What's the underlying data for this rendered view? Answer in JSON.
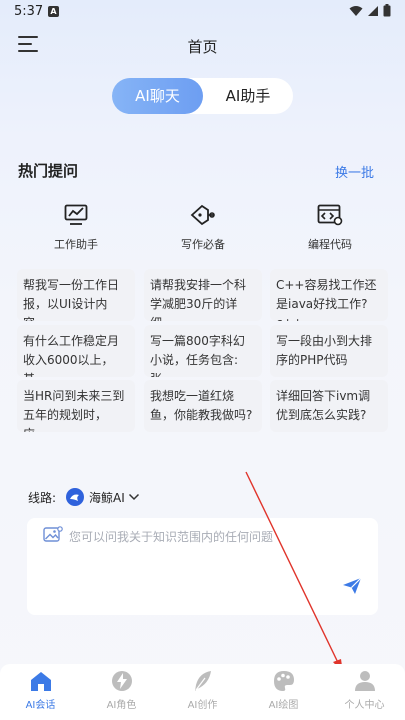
{
  "status": {
    "time": "5:37"
  },
  "header": {
    "title": "首页"
  },
  "tabs": [
    {
      "label": "AI聊天",
      "active": true
    },
    {
      "label": "AI助手",
      "active": false
    }
  ],
  "hot": {
    "title": "热门提问",
    "refresh": "换一批",
    "categories": [
      {
        "icon": "chart-monitor-icon",
        "label": "工作助手"
      },
      {
        "icon": "pen-nib-icon",
        "label": "写作必备"
      },
      {
        "icon": "code-window-icon",
        "label": "编程代码"
      }
    ],
    "cards": [
      {
        "text": "帮我写一份工作日报，以UI设计内容…"
      },
      {
        "text": "请帮我安排一个科学减肥30斤的详细…"
      },
      {
        "text": "C++容易找工作还是iava好找工作?c++…"
      },
      {
        "text": "有什么工作稳定月收入6000以上，基…"
      },
      {
        "text": "写一篇800字科幻小说，任务包含: 张…"
      },
      {
        "text": "写一段由小到大排序的PHP代码"
      },
      {
        "text": "当HR问到未来三到五年的规划时，应…"
      },
      {
        "text": "我想吃一道红烧鱼，你能教我做吗?"
      },
      {
        "text": "详细回答下ivm调优到底怎么实践?"
      }
    ]
  },
  "route": {
    "label": "线路:",
    "model": "海鲸AI"
  },
  "input": {
    "placeholder": "您可以问我关于知识范围内的任何问题"
  },
  "nav": [
    {
      "label": "AI会话",
      "icon": "home-icon",
      "active": true
    },
    {
      "label": "AI角色",
      "icon": "lightning-icon",
      "active": false
    },
    {
      "label": "AI创作",
      "icon": "feather-icon",
      "active": false
    },
    {
      "label": "AI绘图",
      "icon": "palette-icon",
      "active": false
    },
    {
      "label": "个人中心",
      "icon": "person-icon",
      "active": false
    }
  ],
  "colors": {
    "accent": "#3c7ae6",
    "tab_active": "#78a6f4",
    "arrow": "#e0342b"
  }
}
